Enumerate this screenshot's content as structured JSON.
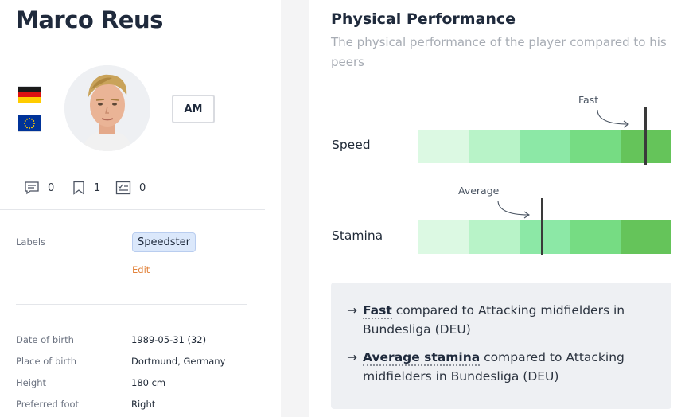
{
  "player": {
    "name": "Marco Reus",
    "position": "AM",
    "flags": [
      "germany-flag",
      "eu-flag"
    ]
  },
  "stats_counts": {
    "comments": "0",
    "bookmarks": "1",
    "checklist": "0"
  },
  "labels": {
    "title": "Labels",
    "chip": "Speedster",
    "edit": "Edit"
  },
  "details": [
    {
      "label": "Date of birth",
      "value": "1989-05-31 (32)"
    },
    {
      "label": "Place of birth",
      "value": "Dortmund, Germany"
    },
    {
      "label": "Height",
      "value": "180 cm"
    },
    {
      "label": "Preferred foot",
      "value": "Right"
    }
  ],
  "performance": {
    "title": "Physical Performance",
    "subtitle": "The physical performance of the player compared to his peers",
    "scale_colors": [
      "#dcf9e3",
      "#b8f3c8",
      "#8ce8a6",
      "#76dc83",
      "#65c45a"
    ],
    "metrics": [
      {
        "label": "Speed",
        "annotation": "Fast",
        "marker_fraction": 0.9
      },
      {
        "label": "Stamina",
        "annotation": "Average",
        "marker_fraction": 0.49
      }
    ],
    "summary": [
      {
        "highlight": "Fast",
        "rest": " compared to Attacking midfielders in Bundesliga (DEU)"
      },
      {
        "highlight": "Average stamina",
        "rest": " compared to Attacking midfielders in Bundesliga (DEU)"
      }
    ]
  }
}
